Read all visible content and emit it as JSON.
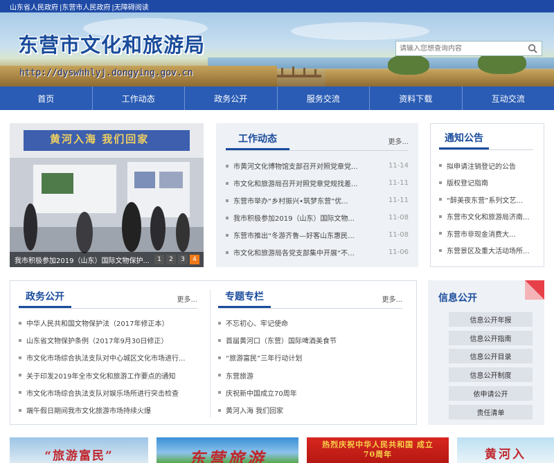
{
  "topbar": {
    "links": [
      "山东省人民政府",
      "|东营市人民政府",
      "|无障碍阅读"
    ]
  },
  "header": {
    "title": "东营市文化和旅游局",
    "url": "http://dyswhhlyj.dongying.gov.cn"
  },
  "search": {
    "placeholder": "请输入您想查询内容"
  },
  "nav": {
    "items": [
      "首页",
      "工作动态",
      "政务公开",
      "服务交流",
      "资料下载",
      "互动交流"
    ]
  },
  "slider": {
    "photo_text": "黄河入海 我们回家",
    "caption": "我市积极参加2019（山东）国际文物保护...",
    "pages": [
      "1",
      "2",
      "3",
      "4"
    ],
    "active_page": "4"
  },
  "work": {
    "title": "工作动态",
    "more": "更多...",
    "items": [
      {
        "text": "市黄河文化博物馆支部召开对照党章党...",
        "date": "11-14"
      },
      {
        "text": "市文化和旅游局召开对照党章党规找差...",
        "date": "11-11"
      },
      {
        "text": "东营市举办“乡村振兴•筑梦东营”优...",
        "date": "11-11"
      },
      {
        "text": "我市积极参加2019（山东）国际文物...",
        "date": "11-08"
      },
      {
        "text": "东营市推出“冬游齐鲁—好客山东惠民...",
        "date": "11-08"
      },
      {
        "text": "市文化和旅游局各党支部集中开展“不...",
        "date": "11-06"
      }
    ]
  },
  "notice": {
    "title": "通知公告",
    "items": [
      "拟申请注销登记的公告",
      "版权登记指南",
      "“醉美夜东营”系列文艺...",
      "东营市文化和旅游局济南...",
      "东营市非现金消费大...",
      "东营景区及重大活动场所..."
    ]
  },
  "gov": {
    "title": "政务公开",
    "more": "更多...",
    "items": [
      "中华人民共和国文物保护法（2017年修正本）",
      "山东省文物保护条例（2017年9月30日修正）",
      "市文化市场综合执法支队对中心城区文化市场进行...",
      "关于印发2019年全市文化和旅游工作要点的通知",
      "市文化市场综合执法支队对娱乐场所进行突击检查",
      "端午假日期间我市文化旅游市场持续火爆"
    ]
  },
  "special": {
    "title": "专题专栏",
    "more": "更多...",
    "items": [
      "不忘初心、牢记使命",
      "首届黄河口（东营）国际啤酒美食节",
      "“旅游富民”三年行动计划",
      "东营旅游",
      "庆祝新中国成立70周年",
      "黄河入海 我们回家"
    ]
  },
  "info": {
    "title": "信息公开",
    "buttons": [
      "信息公开年报",
      "信息公开指南",
      "信息公开目录",
      "信息公开制度",
      "依申请公开",
      "责任清单"
    ]
  },
  "bottom_banners": [
    {
      "text": "“旅游富民”",
      "color": "#c0272d"
    },
    {
      "text": "东营旅游",
      "color": "#c0272d"
    },
    {
      "text": "热烈庆祝中华人民共和国 成立70周年",
      "color": "#f7d44a"
    },
    {
      "text": "黄河入",
      "color": "#c0272d"
    }
  ],
  "colors": {
    "brand": "#1a4c9c",
    "nav": "#2a5cb5",
    "accent": "#f07a18",
    "corner": "#e8404a"
  }
}
